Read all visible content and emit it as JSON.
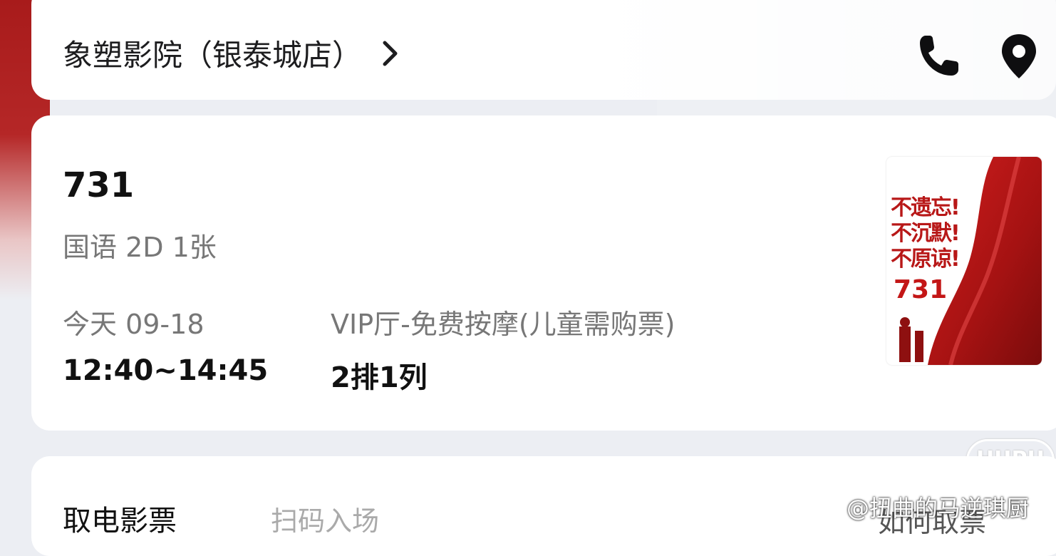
{
  "header": {
    "cinema_name": "象塑影院（银泰城店）",
    "chevron_icon": "chevron-right-icon",
    "phone_icon": "phone-icon",
    "location_icon": "location-pin-icon"
  },
  "ticket": {
    "movie_title": "731",
    "language_format_qty": "国语 2D 1张",
    "date": "今天 09-18",
    "time": "12:40~14:45",
    "hall": "VIP厅-免费按摩(儿童需购票)",
    "seat": "2排1列"
  },
  "poster": {
    "lines": [
      "不遗忘!",
      "不沉默!",
      "不原谅!"
    ],
    "title": "731",
    "accent_color": "#c31616"
  },
  "bottom": {
    "tab_pickup": "取电影票",
    "tab_scan": "扫码入场",
    "help_link": "如何取票",
    "watermark": "@扭曲的马逆琪厨",
    "logo": "HUPU"
  }
}
